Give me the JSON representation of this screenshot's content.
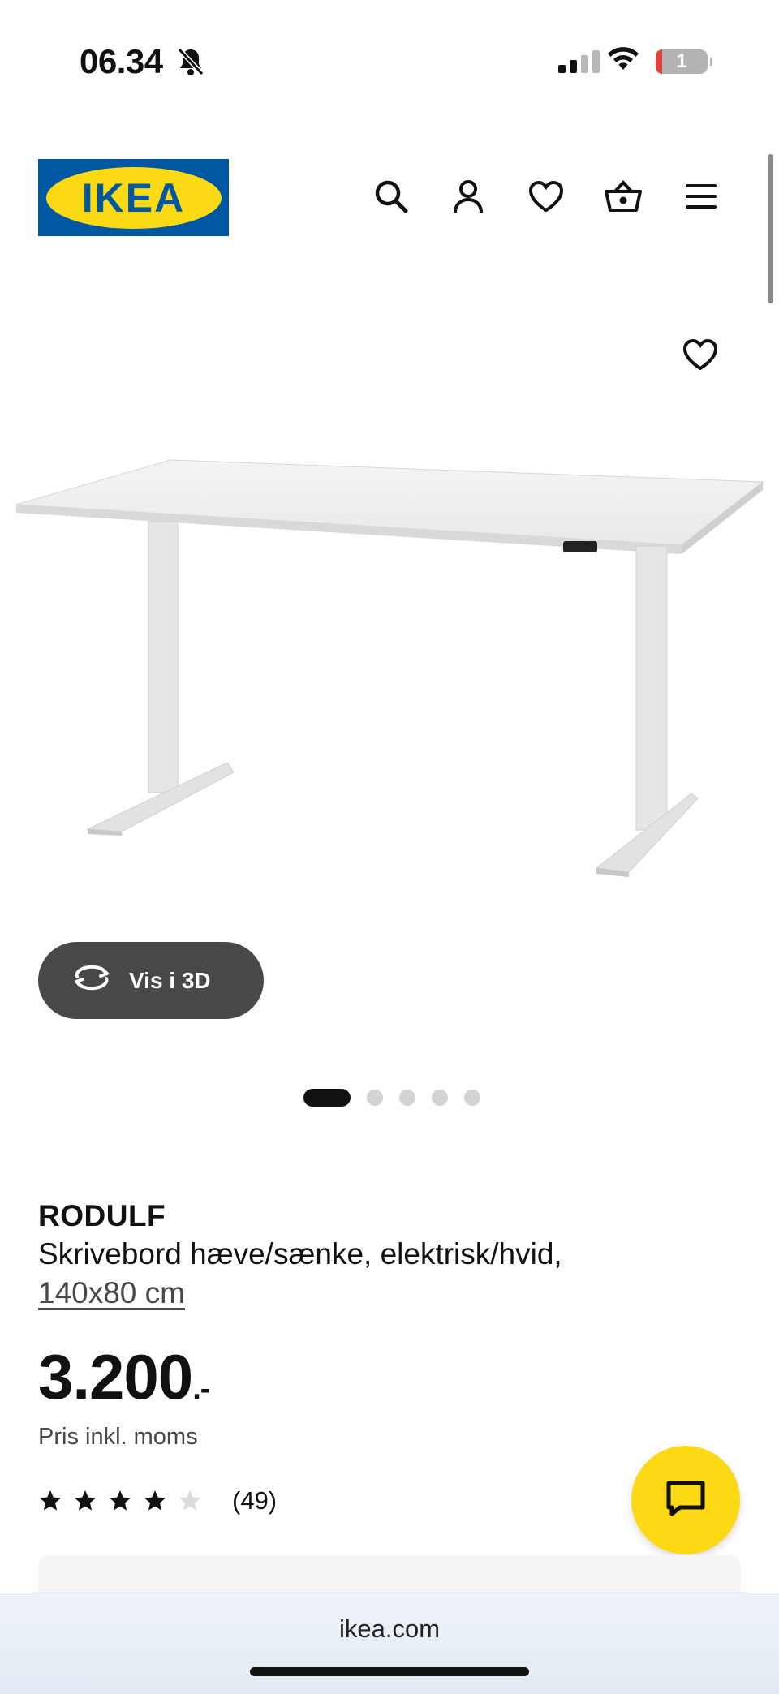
{
  "status_bar": {
    "time": "06.34",
    "battery": "1"
  },
  "header": {
    "logo_text": "IKEA"
  },
  "product": {
    "view_3d_label": "Vis i 3D",
    "image_count": 5,
    "active_image_index": 0,
    "name": "RODULF",
    "description": "Skrivebord hæve/sænke, elektrisk/hvid,",
    "size": "140x80 cm",
    "price": "3.200",
    "price_suffix": ".-",
    "price_note": "Pris inkl. moms",
    "rating": 4,
    "rating_max": 5,
    "review_count": "(49)"
  },
  "browser": {
    "url": "ikea.com"
  },
  "colors": {
    "brand_blue": "#0058a3",
    "brand_yellow": "#fbd914",
    "dark_button": "#484848"
  }
}
